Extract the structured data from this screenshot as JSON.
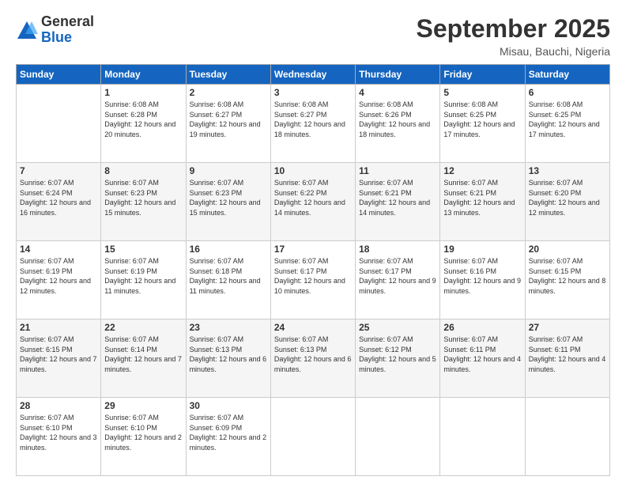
{
  "header": {
    "logo_general": "General",
    "logo_blue": "Blue",
    "month_title": "September 2025",
    "location": "Misau, Bauchi, Nigeria"
  },
  "days_of_week": [
    "Sunday",
    "Monday",
    "Tuesday",
    "Wednesday",
    "Thursday",
    "Friday",
    "Saturday"
  ],
  "weeks": [
    [
      {
        "day": "",
        "sunrise": "",
        "sunset": "",
        "daylight": ""
      },
      {
        "day": "1",
        "sunrise": "Sunrise: 6:08 AM",
        "sunset": "Sunset: 6:28 PM",
        "daylight": "Daylight: 12 hours and 20 minutes."
      },
      {
        "day": "2",
        "sunrise": "Sunrise: 6:08 AM",
        "sunset": "Sunset: 6:27 PM",
        "daylight": "Daylight: 12 hours and 19 minutes."
      },
      {
        "day": "3",
        "sunrise": "Sunrise: 6:08 AM",
        "sunset": "Sunset: 6:27 PM",
        "daylight": "Daylight: 12 hours and 18 minutes."
      },
      {
        "day": "4",
        "sunrise": "Sunrise: 6:08 AM",
        "sunset": "Sunset: 6:26 PM",
        "daylight": "Daylight: 12 hours and 18 minutes."
      },
      {
        "day": "5",
        "sunrise": "Sunrise: 6:08 AM",
        "sunset": "Sunset: 6:25 PM",
        "daylight": "Daylight: 12 hours and 17 minutes."
      },
      {
        "day": "6",
        "sunrise": "Sunrise: 6:08 AM",
        "sunset": "Sunset: 6:25 PM",
        "daylight": "Daylight: 12 hours and 17 minutes."
      }
    ],
    [
      {
        "day": "7",
        "sunrise": "Sunrise: 6:07 AM",
        "sunset": "Sunset: 6:24 PM",
        "daylight": "Daylight: 12 hours and 16 minutes."
      },
      {
        "day": "8",
        "sunrise": "Sunrise: 6:07 AM",
        "sunset": "Sunset: 6:23 PM",
        "daylight": "Daylight: 12 hours and 15 minutes."
      },
      {
        "day": "9",
        "sunrise": "Sunrise: 6:07 AM",
        "sunset": "Sunset: 6:23 PM",
        "daylight": "Daylight: 12 hours and 15 minutes."
      },
      {
        "day": "10",
        "sunrise": "Sunrise: 6:07 AM",
        "sunset": "Sunset: 6:22 PM",
        "daylight": "Daylight: 12 hours and 14 minutes."
      },
      {
        "day": "11",
        "sunrise": "Sunrise: 6:07 AM",
        "sunset": "Sunset: 6:21 PM",
        "daylight": "Daylight: 12 hours and 14 minutes."
      },
      {
        "day": "12",
        "sunrise": "Sunrise: 6:07 AM",
        "sunset": "Sunset: 6:21 PM",
        "daylight": "Daylight: 12 hours and 13 minutes."
      },
      {
        "day": "13",
        "sunrise": "Sunrise: 6:07 AM",
        "sunset": "Sunset: 6:20 PM",
        "daylight": "Daylight: 12 hours and 12 minutes."
      }
    ],
    [
      {
        "day": "14",
        "sunrise": "Sunrise: 6:07 AM",
        "sunset": "Sunset: 6:19 PM",
        "daylight": "Daylight: 12 hours and 12 minutes."
      },
      {
        "day": "15",
        "sunrise": "Sunrise: 6:07 AM",
        "sunset": "Sunset: 6:19 PM",
        "daylight": "Daylight: 12 hours and 11 minutes."
      },
      {
        "day": "16",
        "sunrise": "Sunrise: 6:07 AM",
        "sunset": "Sunset: 6:18 PM",
        "daylight": "Daylight: 12 hours and 11 minutes."
      },
      {
        "day": "17",
        "sunrise": "Sunrise: 6:07 AM",
        "sunset": "Sunset: 6:17 PM",
        "daylight": "Daylight: 12 hours and 10 minutes."
      },
      {
        "day": "18",
        "sunrise": "Sunrise: 6:07 AM",
        "sunset": "Sunset: 6:17 PM",
        "daylight": "Daylight: 12 hours and 9 minutes."
      },
      {
        "day": "19",
        "sunrise": "Sunrise: 6:07 AM",
        "sunset": "Sunset: 6:16 PM",
        "daylight": "Daylight: 12 hours and 9 minutes."
      },
      {
        "day": "20",
        "sunrise": "Sunrise: 6:07 AM",
        "sunset": "Sunset: 6:15 PM",
        "daylight": "Daylight: 12 hours and 8 minutes."
      }
    ],
    [
      {
        "day": "21",
        "sunrise": "Sunrise: 6:07 AM",
        "sunset": "Sunset: 6:15 PM",
        "daylight": "Daylight: 12 hours and 7 minutes."
      },
      {
        "day": "22",
        "sunrise": "Sunrise: 6:07 AM",
        "sunset": "Sunset: 6:14 PM",
        "daylight": "Daylight: 12 hours and 7 minutes."
      },
      {
        "day": "23",
        "sunrise": "Sunrise: 6:07 AM",
        "sunset": "Sunset: 6:13 PM",
        "daylight": "Daylight: 12 hours and 6 minutes."
      },
      {
        "day": "24",
        "sunrise": "Sunrise: 6:07 AM",
        "sunset": "Sunset: 6:13 PM",
        "daylight": "Daylight: 12 hours and 6 minutes."
      },
      {
        "day": "25",
        "sunrise": "Sunrise: 6:07 AM",
        "sunset": "Sunset: 6:12 PM",
        "daylight": "Daylight: 12 hours and 5 minutes."
      },
      {
        "day": "26",
        "sunrise": "Sunrise: 6:07 AM",
        "sunset": "Sunset: 6:11 PM",
        "daylight": "Daylight: 12 hours and 4 minutes."
      },
      {
        "day": "27",
        "sunrise": "Sunrise: 6:07 AM",
        "sunset": "Sunset: 6:11 PM",
        "daylight": "Daylight: 12 hours and 4 minutes."
      }
    ],
    [
      {
        "day": "28",
        "sunrise": "Sunrise: 6:07 AM",
        "sunset": "Sunset: 6:10 PM",
        "daylight": "Daylight: 12 hours and 3 minutes."
      },
      {
        "day": "29",
        "sunrise": "Sunrise: 6:07 AM",
        "sunset": "Sunset: 6:10 PM",
        "daylight": "Daylight: 12 hours and 2 minutes."
      },
      {
        "day": "30",
        "sunrise": "Sunrise: 6:07 AM",
        "sunset": "Sunset: 6:09 PM",
        "daylight": "Daylight: 12 hours and 2 minutes."
      },
      {
        "day": "",
        "sunrise": "",
        "sunset": "",
        "daylight": ""
      },
      {
        "day": "",
        "sunrise": "",
        "sunset": "",
        "daylight": ""
      },
      {
        "day": "",
        "sunrise": "",
        "sunset": "",
        "daylight": ""
      },
      {
        "day": "",
        "sunrise": "",
        "sunset": "",
        "daylight": ""
      }
    ]
  ]
}
